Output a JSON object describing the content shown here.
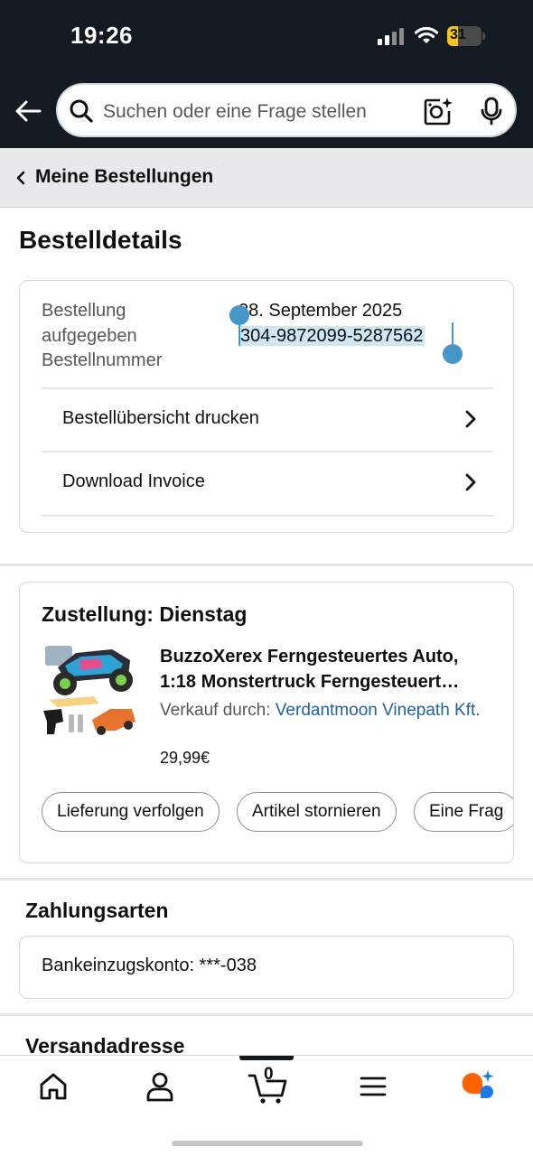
{
  "status_bar": {
    "time": "19:26",
    "battery_level": "31",
    "battery_fraction": 0.31,
    "icons": [
      "cellular-signal-icon",
      "wifi-icon",
      "battery-charging-icon"
    ]
  },
  "header": {
    "back_icon": "arrow-left-icon",
    "search": {
      "placeholder": "Suchen oder eine Frage stellen",
      "icons": [
        "search-icon",
        "camera-lens-icon",
        "microphone-icon"
      ]
    }
  },
  "breadcrumb": {
    "label": "Meine Bestellungen"
  },
  "page": {
    "title": "Bestelldetails"
  },
  "order": {
    "placed_label": "Bestellung aufgegeben",
    "number_label": "Bestellnummer",
    "date": "28. September 2025",
    "number": "304-9872099-5287562",
    "links": [
      {
        "label": "Bestellübersicht drucken"
      },
      {
        "label": "Download Invoice"
      }
    ]
  },
  "delivery": {
    "title": "Zustellung: Dienstag",
    "product": {
      "title_line1": "BuzzoXerex Ferngesteuertes Auto,",
      "title_line2": "1:18 Monstertruck Ferngesteuert…",
      "seller_prefix": "Verkauf durch: ",
      "seller_name": "Verdantmoon Vinepath Kft.",
      "price": "29,99€"
    },
    "actions": [
      {
        "label": "Lieferung verfolgen"
      },
      {
        "label": "Artikel stornieren"
      },
      {
        "label": "Eine Frag"
      }
    ]
  },
  "payment": {
    "title": "Zahlungsarten",
    "method": "Bankeinzugskonto: ***-038"
  },
  "shipping": {
    "title": "Versandadresse"
  },
  "bottom_nav": {
    "items": [
      "home-icon",
      "account-icon",
      "cart-icon",
      "menu-icon",
      "rufus-ai-icon"
    ],
    "cart_count": "0",
    "colors": {
      "accent_orange": "#ff6200",
      "accent_blue": "#1a7ce6"
    }
  },
  "colors": {
    "header_bg": "#131a22",
    "link": "#2162a1",
    "selection": "#cfe6f3",
    "selection_handle": "#4597c8"
  }
}
